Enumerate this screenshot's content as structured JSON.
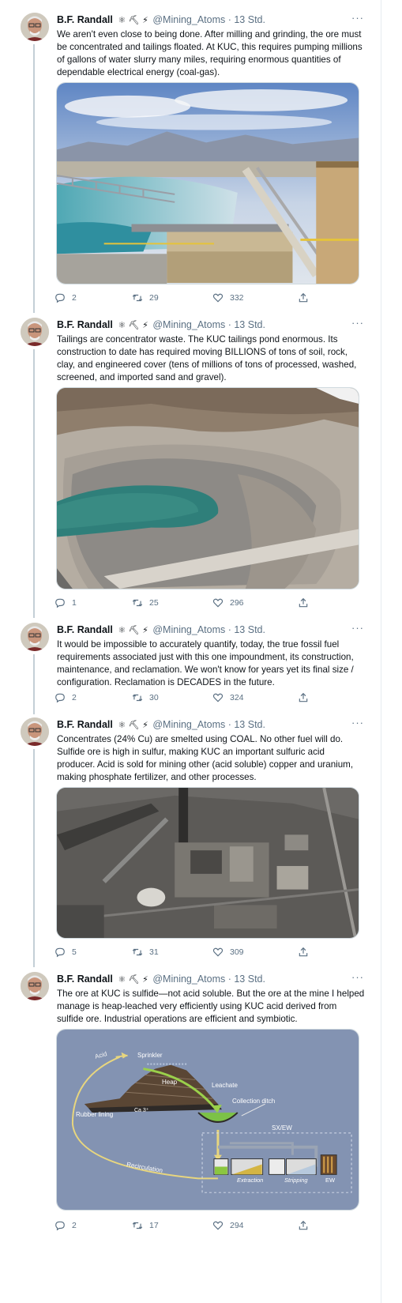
{
  "tweets": [
    {
      "author": "B.F. Randall",
      "emojis": "⚛ ⛏ ⚡",
      "handle_time": "@Mining_Atoms · 13 Std.",
      "more": "···",
      "text": "We aren't even close to being done. After milling and grinding, the ore must be concentrated and tailings floated. At KUC, this requires pumping millions of gallons of water slurry many miles, requiring enormous quantities of dependable electrical energy (coal-gas).",
      "replies": "2",
      "retweets": "29",
      "likes": "332"
    },
    {
      "author": "B.F. Randall",
      "emojis": "⚛ ⛏ ⚡",
      "handle_time": "@Mining_Atoms · 13 Std.",
      "more": "···",
      "text": "Tailings are concentrator waste. The KUC tailings pond enormous. Its construction to date has required moving BILLIONS of tons of soil, rock, clay, and engineered cover (tens of millions of tons of processed, washed, screened, and imported sand and gravel).",
      "replies": "1",
      "retweets": "25",
      "likes": "296"
    },
    {
      "author": "B.F. Randall",
      "emojis": "⚛ ⛏ ⚡",
      "handle_time": "@Mining_Atoms · 13 Std.",
      "more": "···",
      "text": "It would be impossible to accurately quantify, today, the true fossil fuel requirements associated just with this one impoundment, its construction, maintenance, and reclamation. We won't know for years yet its final size / configuration. Reclamation is DECADES in the future.",
      "replies": "2",
      "retweets": "30",
      "likes": "324"
    },
    {
      "author": "B.F. Randall",
      "emojis": "⚛ ⛏ ⚡",
      "handle_time": "@Mining_Atoms · 13 Std.",
      "more": "···",
      "text": "Concentrates (24% Cu) are smelted using COAL. No other fuel will do. Sulfide ore is high in sulfur, making KUC an important sulfuric acid producer. Acid is sold for mining other (acid soluble) copper and uranium, making phosphate fertilizer, and other processes.",
      "replies": "5",
      "retweets": "31",
      "likes": "309"
    },
    {
      "author": "B.F. Randall",
      "emojis": "⚛ ⛏ ⚡",
      "handle_time": "@Mining_Atoms · 13 Std.",
      "more": "···",
      "text": "The ore at KUC is sulfide—not acid soluble. But the ore at the mine I helped manage is heap-leached very efficiently using KUC acid derived from sulfide ore. Industrial operations are efficient and symbiotic.",
      "replies": "2",
      "retweets": "17",
      "likes": "294"
    }
  ],
  "diagram": {
    "acid": "Acid",
    "sprinkler": "Sprinkler",
    "heap": "Heap",
    "leachate": "Leachate",
    "collection_ditch": "Collection ditch",
    "rubber_lining": "Rubber lining",
    "ca": "Ca 3⁺",
    "sxew": "SX/EW",
    "recirculation": "Recirculation",
    "extraction": "Extraction",
    "stripping": "Stripping",
    "ew": "EW"
  },
  "colors": {
    "thread_line": "#c4cfd6",
    "secondary_text": "#5b7083",
    "diagram_bg": "#8393b2"
  }
}
